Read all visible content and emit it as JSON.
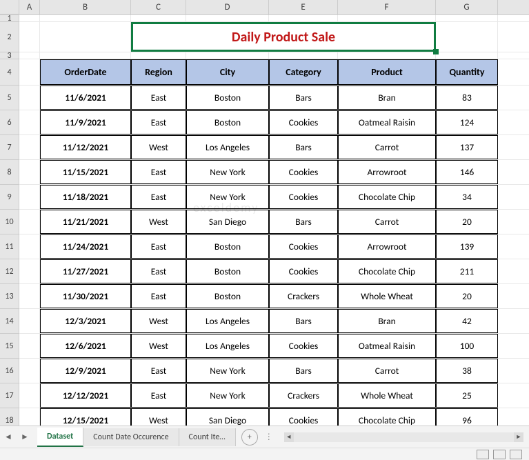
{
  "columns": [
    "A",
    "B",
    "C",
    "D",
    "E",
    "F",
    "G"
  ],
  "title": "Daily Product Sale",
  "chart_data": {
    "type": "table",
    "title": "Daily Product Sale",
    "headers": [
      "OrderDate",
      "Region",
      "City",
      "Category",
      "Product",
      "Quantity"
    ],
    "rows": [
      [
        "11/6/2021",
        "East",
        "Boston",
        "Bars",
        "Bran",
        83
      ],
      [
        "11/9/2021",
        "East",
        "Boston",
        "Cookies",
        "Oatmeal Raisin",
        124
      ],
      [
        "11/12/2021",
        "West",
        "Los Angeles",
        "Bars",
        "Carrot",
        137
      ],
      [
        "11/15/2021",
        "East",
        "New York",
        "Cookies",
        "Arrowroot",
        146
      ],
      [
        "11/18/2021",
        "East",
        "New York",
        "Cookies",
        "Chocolate Chip",
        34
      ],
      [
        "11/21/2021",
        "West",
        "San Diego",
        "Bars",
        "Carrot",
        20
      ],
      [
        "11/24/2021",
        "East",
        "Boston",
        "Cookies",
        "Arrowroot",
        139
      ],
      [
        "11/27/2021",
        "East",
        "Boston",
        "Cookies",
        "Chocolate Chip",
        211
      ],
      [
        "11/30/2021",
        "East",
        "Boston",
        "Crackers",
        "Whole Wheat",
        20
      ],
      [
        "12/3/2021",
        "West",
        "Los Angeles",
        "Bars",
        "Bran",
        42
      ],
      [
        "12/6/2021",
        "West",
        "Los Angeles",
        "Cookies",
        "Oatmeal Raisin",
        100
      ],
      [
        "12/9/2021",
        "East",
        "New York",
        "Bars",
        "Carrot",
        38
      ],
      [
        "12/12/2021",
        "East",
        "New York",
        "Crackers",
        "Whole Wheat",
        25
      ],
      [
        "12/15/2021",
        "West",
        "San Diego",
        "Cookies",
        "Chocolate Chip",
        96
      ]
    ]
  },
  "sheet_tabs": {
    "active": "Dataset",
    "others": [
      "Count Date Occurence",
      "Count Ite…"
    ]
  },
  "watermark": "exceldemy"
}
